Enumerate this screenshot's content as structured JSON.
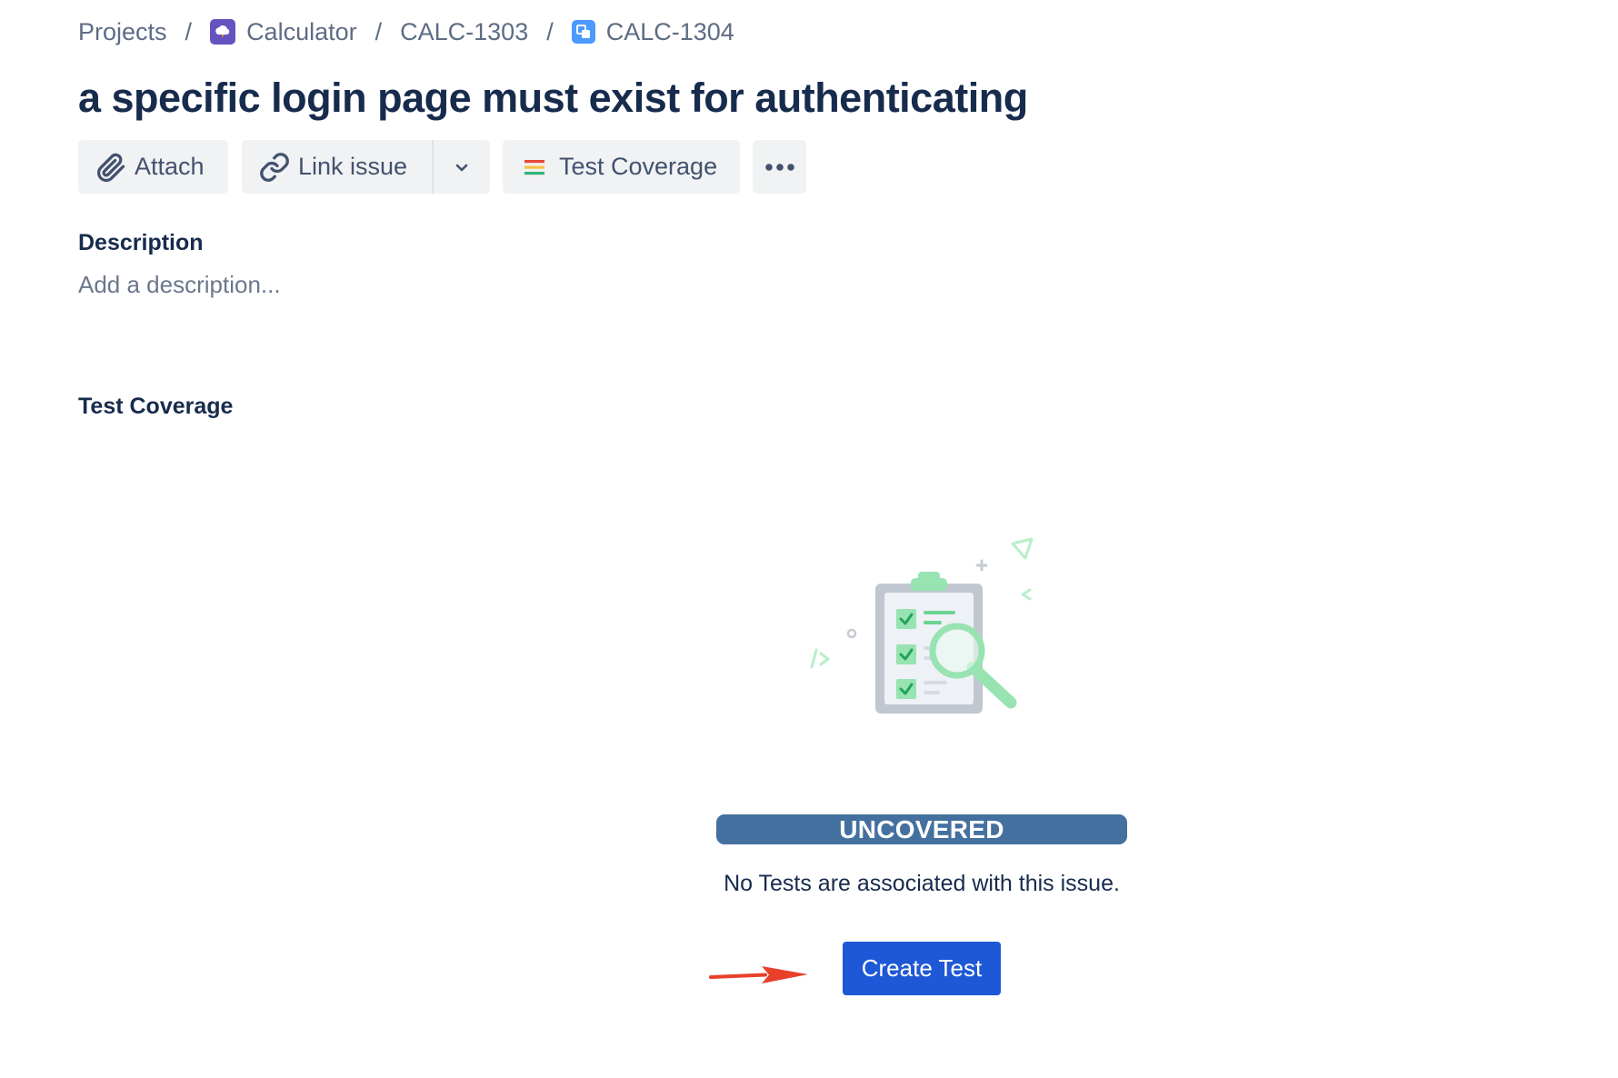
{
  "breadcrumb": {
    "projects": "Projects",
    "separator": "/",
    "project": "Calculator",
    "parent_issue": "CALC-1303",
    "issue": "CALC-1304",
    "project_icon_color": "#6554c0",
    "issue_icon_color": "#4c9aff"
  },
  "issue": {
    "title": "a specific login page must exist for authenticating"
  },
  "toolbar": {
    "attach_label": "Attach",
    "link_issue_label": "Link issue",
    "test_coverage_label": "Test Coverage",
    "icons": [
      "paperclip-icon",
      "link-icon",
      "chevron-down-icon",
      "coverage-bars-icon",
      "more-icon"
    ]
  },
  "description": {
    "heading": "Description",
    "placeholder": "Add a description..."
  },
  "test_coverage": {
    "heading": "Test Coverage",
    "status": "UNCOVERED",
    "status_color": "#44709f",
    "message": "No Tests are associated with this issue.",
    "create_label": "Create Test",
    "button_color": "#1e58d6",
    "illustration": "clipboard-magnifier-icon"
  },
  "annotation": {
    "arrow_color": "#e8402a"
  }
}
